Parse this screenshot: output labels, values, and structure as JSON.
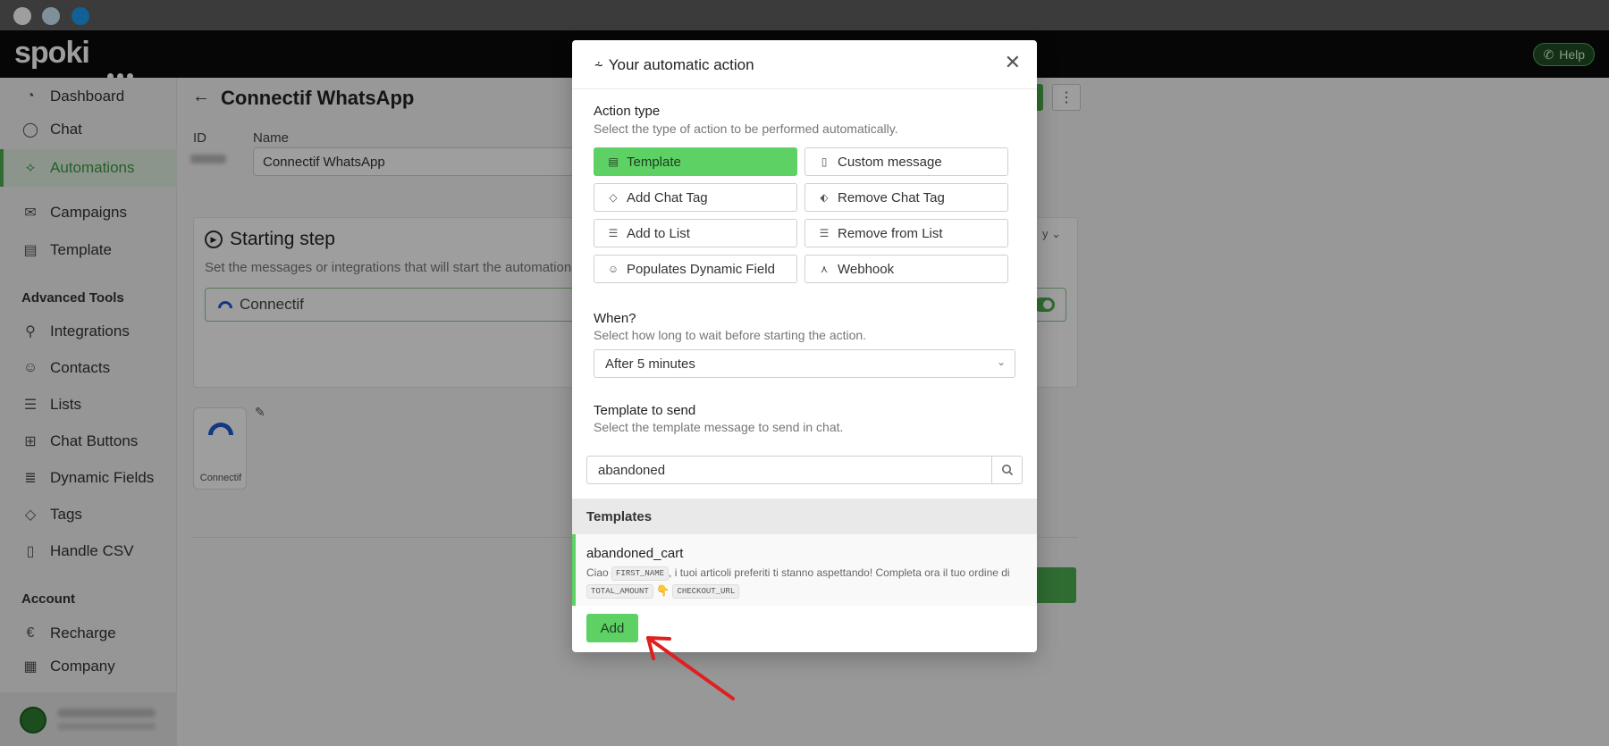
{
  "app": {
    "logo": "spoki",
    "help_label": "Help"
  },
  "sidebar": {
    "items": [
      {
        "label": "Dashboard",
        "icon": "dashboard-icon"
      },
      {
        "label": "Chat",
        "icon": "chat-icon"
      },
      {
        "label": "Automations",
        "icon": "automations-icon",
        "active": true
      },
      {
        "label": "Campaigns",
        "icon": "campaigns-icon"
      },
      {
        "label": "Template",
        "icon": "template-icon"
      }
    ],
    "advanced_title": "Advanced Tools",
    "advanced": [
      {
        "label": "Integrations",
        "icon": "integrations-icon"
      },
      {
        "label": "Contacts",
        "icon": "contacts-icon"
      },
      {
        "label": "Lists",
        "icon": "lists-icon"
      },
      {
        "label": "Chat Buttons",
        "icon": "chat-buttons-icon"
      },
      {
        "label": "Dynamic Fields",
        "icon": "dynamic-fields-icon"
      },
      {
        "label": "Tags",
        "icon": "tags-icon"
      },
      {
        "label": "Handle CSV",
        "icon": "csv-icon"
      }
    ],
    "account_title": "Account",
    "account": [
      {
        "label": "Recharge",
        "icon": "euro-icon"
      },
      {
        "label": "Company",
        "icon": "company-icon"
      }
    ]
  },
  "page": {
    "title": "Connectif WhatsApp",
    "id_label": "ID",
    "name_label": "Name",
    "name_value": "Connectif WhatsApp",
    "step_title": "Starting step",
    "step_sub": "Set the messages or integrations that will start the automation.",
    "trigger_name": "Connectif",
    "node_label": "Connectif",
    "by_label": "y"
  },
  "modal": {
    "title": "Your automatic action",
    "action_type_title": "Action type",
    "action_type_sub": "Select the type of action to be performed automatically.",
    "actions": [
      {
        "label": "Template",
        "icon": "template-icon",
        "selected": true
      },
      {
        "label": "Custom message",
        "icon": "document-icon"
      },
      {
        "label": "Add Chat Tag",
        "icon": "tag-icon"
      },
      {
        "label": "Remove Chat Tag",
        "icon": "tag-remove-icon"
      },
      {
        "label": "Add to List",
        "icon": "list-icon"
      },
      {
        "label": "Remove from List",
        "icon": "list-icon"
      },
      {
        "label": "Populates Dynamic Field",
        "icon": "user-icon"
      },
      {
        "label": "Webhook",
        "icon": "webhook-icon"
      }
    ],
    "when_title": "When?",
    "when_sub": "Select how long to wait before starting the action.",
    "when_value": "After 5 minutes",
    "template_title": "Template to send",
    "template_sub": "Select the template message to send in chat.",
    "search_value": "abandoned",
    "templates_header": "Templates",
    "template_item": {
      "name": "abandoned_cart",
      "body_start": "Ciao",
      "var1": "FIRST_NAME",
      "body_mid": ", i tuoi articoli preferiti ti stanno aspettando! Completa ora il tuo ordine di",
      "var2": "TOTAL_AMOUNT",
      "emoji": "👇",
      "var3": "CHECKOUT_URL"
    },
    "add_label": "Add"
  },
  "colors": {
    "accent_green": "#5dd164",
    "annotation_red": "#e02020"
  }
}
